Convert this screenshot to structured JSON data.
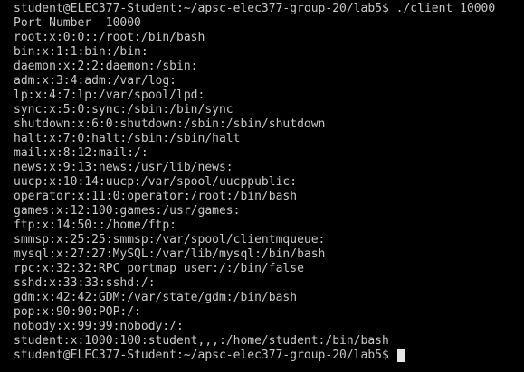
{
  "terminal": {
    "command_line": "student@ELEC377-Student:~/apsc-elec377-group-20/lab5$ ./client 10000",
    "output": [
      "Port Number  10000",
      "root:x:0:0::/root:/bin/bash",
      "bin:x:1:1:bin:/bin:",
      "daemon:x:2:2:daemon:/sbin:",
      "adm:x:3:4:adm:/var/log:",
      "lp:x:4:7:lp:/var/spool/lpd:",
      "sync:x:5:0:sync:/sbin:/bin/sync",
      "shutdown:x:6:0:shutdown:/sbin:/sbin/shutdown",
      "halt:x:7:0:halt:/sbin:/sbin/halt",
      "mail:x:8:12:mail:/:",
      "news:x:9:13:news:/usr/lib/news:",
      "uucp:x:10:14:uucp:/var/spool/uucppublic:",
      "operator:x:11:0:operator:/root:/bin/bash",
      "games:x:12:100:games:/usr/games:",
      "ftp:x:14:50::/home/ftp:",
      "smmsp:x:25:25:smmsp:/var/spool/clientmqueue:",
      "mysql:x:27:27:MySQL:/var/lib/mysql:/bin/bash",
      "rpc:x:32:32:RPC portmap user:/:/bin/false",
      "sshd:x:33:33:sshd:/:",
      "gdm:x:42:42:GDM:/var/state/gdm:/bin/bash",
      "pop:x:90:90:POP:/:",
      "nobody:x:99:99:nobody:/:",
      "student:x:1000:100:student,,,:/home/student:/bin/bash"
    ],
    "prompt": "student@ELEC377-Student:~/apsc-elec377-group-20/lab5$ ",
    "colors": {
      "background": "#000000",
      "text": "#c8c8c8",
      "cursor": "#e6e6e6"
    }
  }
}
